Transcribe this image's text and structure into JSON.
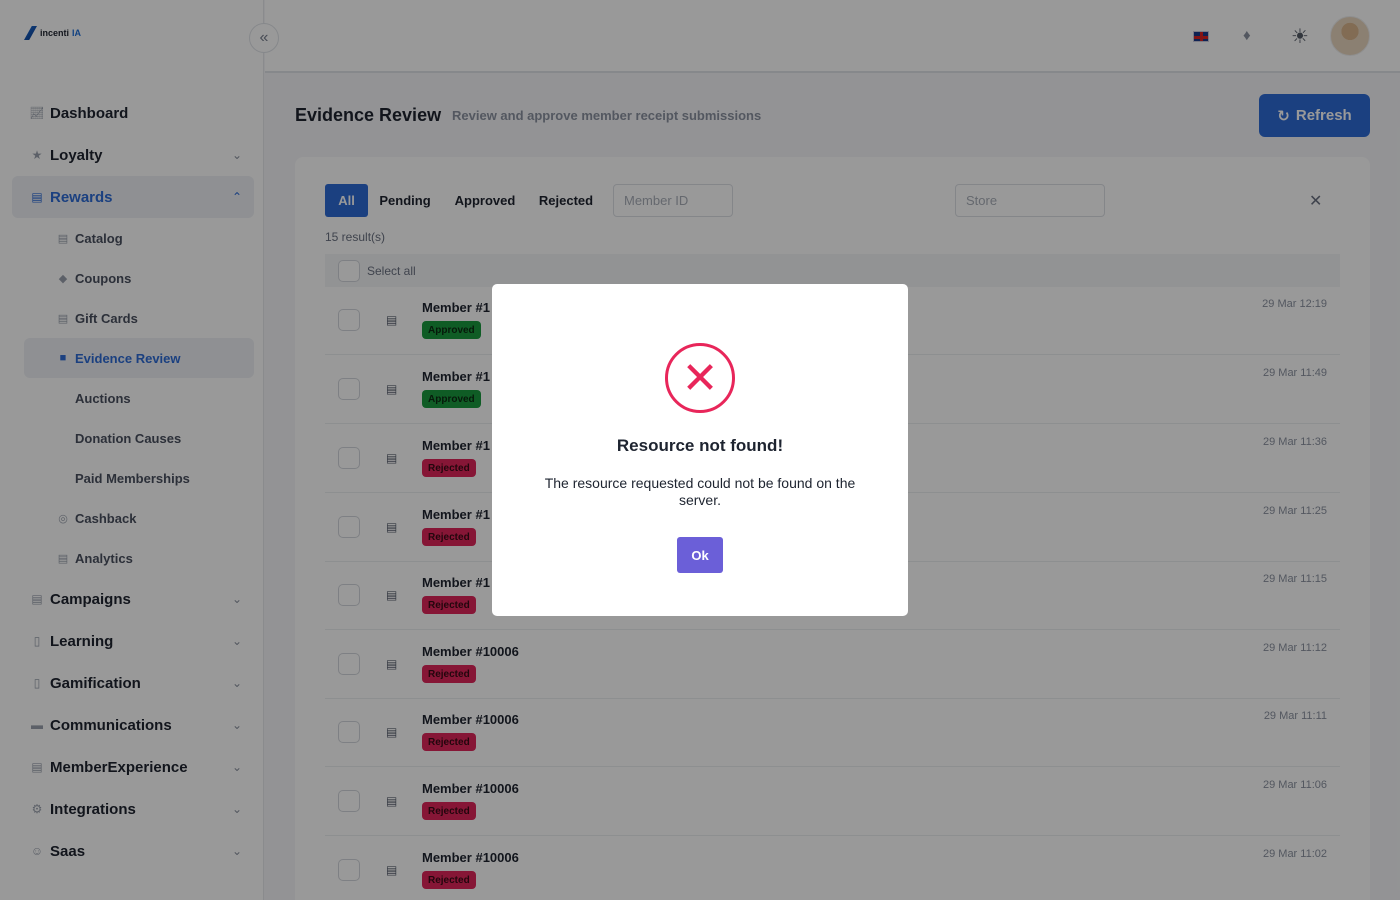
{
  "app": {
    "logo_prefix": "incenti",
    "logo_suffix": "IA"
  },
  "sidebar": {
    "items": [
      {
        "label": "Dashboard",
        "icon": "chart-icon"
      },
      {
        "label": "Loyalty",
        "icon": "star-icon"
      },
      {
        "label": "Rewards",
        "icon": "gift-icon"
      },
      {
        "label": "Campaigns",
        "icon": "calendar-icon"
      },
      {
        "label": "Learning",
        "icon": "book-icon"
      },
      {
        "label": "Gamification",
        "icon": "trophy-icon"
      },
      {
        "label": "Communications",
        "icon": "chat-icon"
      },
      {
        "label": "MemberExperience",
        "icon": "inbox-icon"
      },
      {
        "label": "Integrations",
        "icon": "plug-icon"
      },
      {
        "label": "Saas",
        "icon": "users-icon"
      }
    ],
    "rewards_sub": [
      {
        "label": "Catalog"
      },
      {
        "label": "Coupons"
      },
      {
        "label": "Gift Cards"
      },
      {
        "label": "Evidence Review"
      },
      {
        "label": "Auctions"
      },
      {
        "label": "Donation Causes"
      },
      {
        "label": "Paid Memberships"
      },
      {
        "label": "Cashback"
      },
      {
        "label": "Analytics"
      }
    ]
  },
  "header": {
    "title": "Evidence Review",
    "subtitle": "Review and approve member receipt submissions",
    "refresh_label": "Refresh"
  },
  "filters": {
    "tabs": [
      "All",
      "Pending",
      "Approved",
      "Rejected"
    ],
    "active_tab": "All",
    "member_id_placeholder": "Member ID",
    "store_placeholder": "Store",
    "results": "15 result(s)",
    "select_all": "Select all"
  },
  "rows": [
    {
      "member": "Member #1",
      "status": "Approved",
      "time": "29 Mar 12:19"
    },
    {
      "member": "Member #1",
      "status": "Approved",
      "time": "29 Mar 11:49"
    },
    {
      "member": "Member #1",
      "status": "Rejected",
      "time": "29 Mar 11:36"
    },
    {
      "member": "Member #1",
      "status": "Rejected",
      "time": "29 Mar 11:25"
    },
    {
      "member": "Member #1",
      "status": "Rejected",
      "time": "29 Mar 11:15"
    },
    {
      "member": "Member #10006",
      "status": "Rejected",
      "time": "29 Mar 11:12"
    },
    {
      "member": "Member #10006",
      "status": "Rejected",
      "time": "29 Mar 11:11"
    },
    {
      "member": "Member #10006",
      "status": "Rejected",
      "time": "29 Mar 11:06"
    },
    {
      "member": "Member #10006",
      "status": "Rejected",
      "time": "29 Mar 11:02"
    }
  ],
  "modal": {
    "title": "Resource not found!",
    "message": "The resource requested could not be found on the server.",
    "ok_label": "Ok"
  },
  "colors": {
    "primary": "#2d6bd6",
    "approved": "#1a9a3e",
    "rejected": "#e0265a",
    "ok_button": "#6b5fd8"
  }
}
